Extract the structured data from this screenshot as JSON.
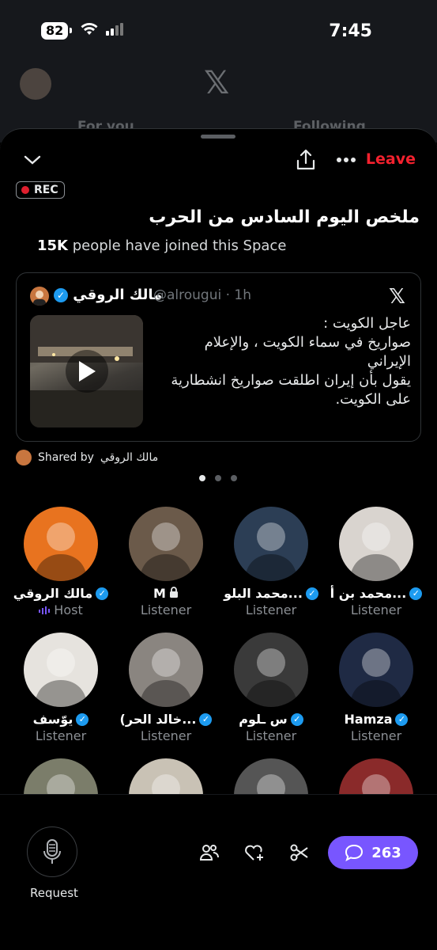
{
  "status_bar": {
    "battery": "82",
    "time": "7:45"
  },
  "background": {
    "tab_for_you": "For you",
    "tab_following": "Following"
  },
  "space": {
    "leave_label": "Leave",
    "rec_label": "REC",
    "title": "ملخص اليوم السادس من الحرب",
    "joined_count": "15K",
    "joined_text": " people have joined this Space"
  },
  "tweet": {
    "author_name": "مالك الروقي",
    "handle_time": "@alrougui · 1h",
    "text_lines": [
      "عاجل الكويت :",
      "صواريخ في سماء الكويت ، والإعلام الإيراني",
      "يقول بأن إيران اطلقت صواريخ انشطارية",
      "على الكويت."
    ]
  },
  "shared": {
    "prefix": "Shared by",
    "name": "مالك الروقي"
  },
  "speakers": [
    {
      "name": "مالك الروقي",
      "role": "Host",
      "verified": true,
      "color": "#e8731f"
    },
    {
      "name": "M",
      "role": "Listener",
      "verified": false,
      "locked": true,
      "color": "#6b5a4a"
    },
    {
      "name": "محمد البلو...",
      "role": "Listener",
      "verified": true,
      "color": "#2c3e55"
    },
    {
      "name": "محمد بن أ...",
      "role": "Listener",
      "verified": true,
      "color": "#d9d4cf"
    },
    {
      "name": "يوّسف",
      "role": "Listener",
      "verified": true,
      "color": "#e6e3de"
    },
    {
      "name": "(خالد الحر...",
      "role": "Listener",
      "verified": true,
      "color": "#8a8580"
    },
    {
      "name": "س ـلوم",
      "role": "Listener",
      "verified": true,
      "color": "#3a3a3a"
    },
    {
      "name": "Hamza",
      "role": "Listener",
      "verified": true,
      "color": "#1f2a44"
    },
    {
      "name": "",
      "role": "",
      "color": "#7b7d6a"
    },
    {
      "name": "",
      "role": "",
      "color": "#c9c2b5"
    },
    {
      "name": "",
      "role": "",
      "color": "#555"
    },
    {
      "name": "",
      "role": "",
      "color": "#8a2a2a"
    }
  ],
  "bottom": {
    "request_label": "Request",
    "comment_count": "263"
  }
}
